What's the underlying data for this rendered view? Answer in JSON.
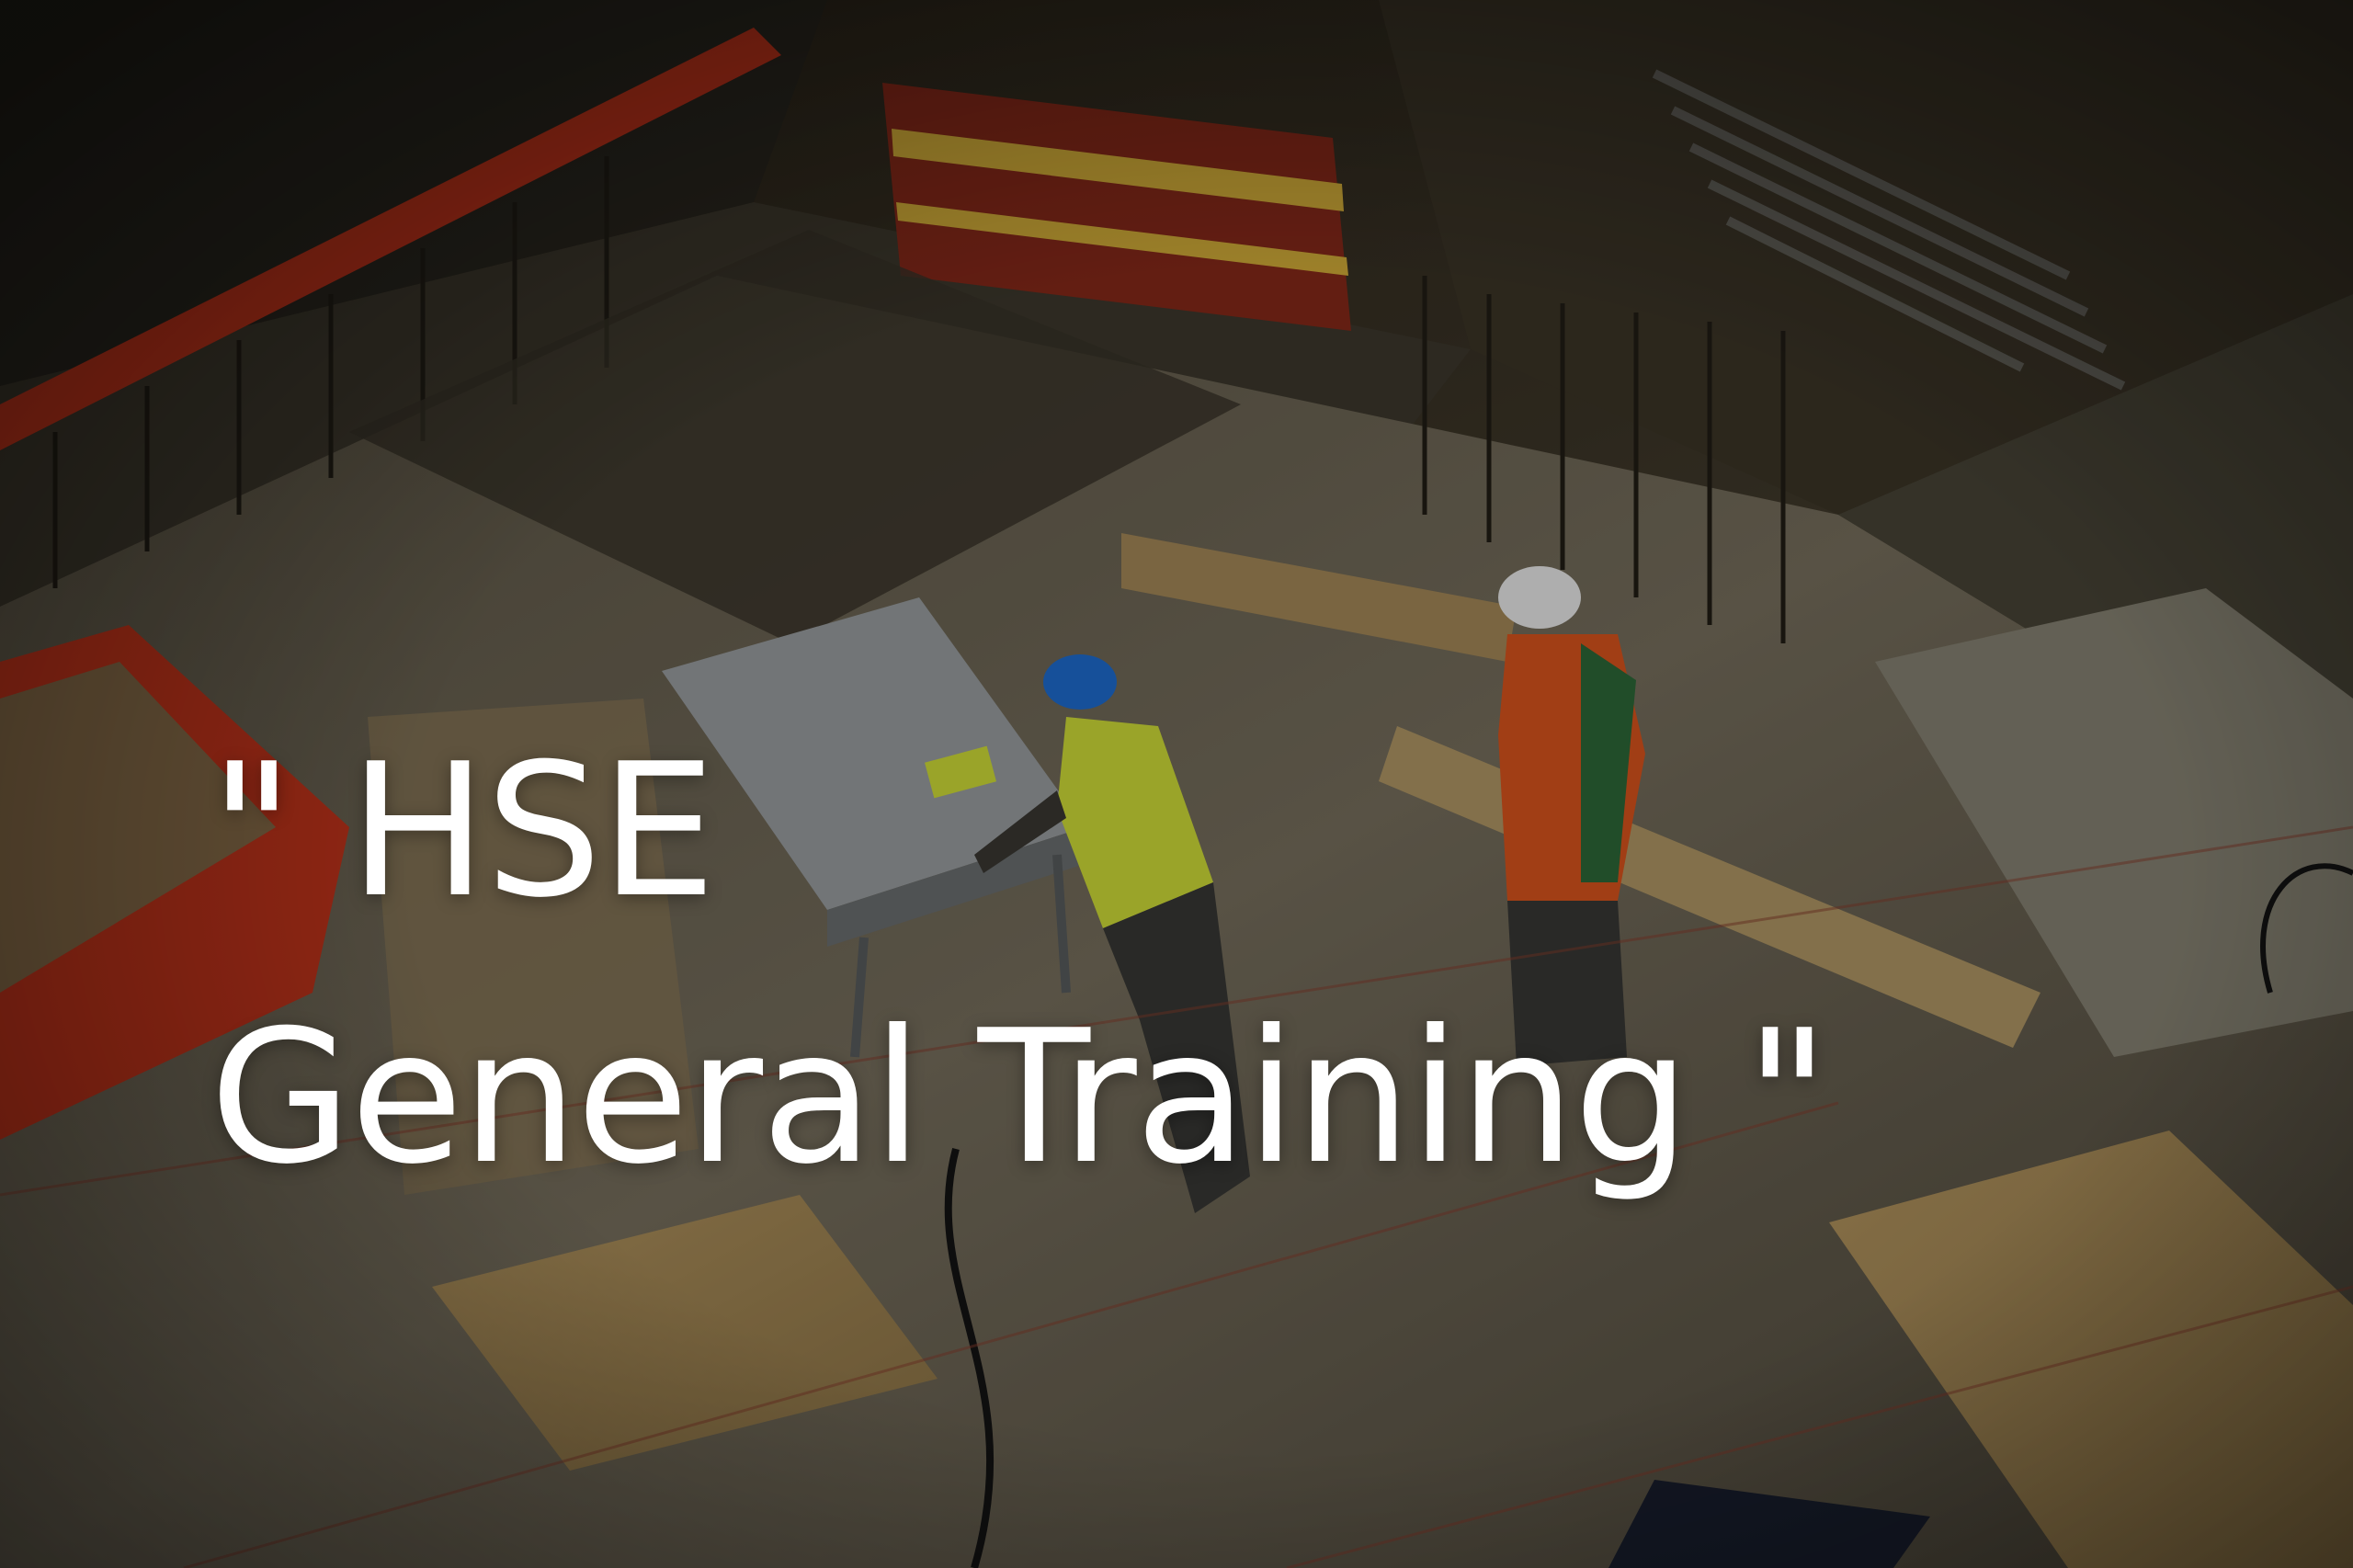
{
  "headline": {
    "line1": "\" HSE",
    "line2": "General Training \""
  },
  "colors": {
    "text": "#ffffff",
    "barrier": "#d9391e",
    "vest_yellow": "#d6e33a",
    "vest_orange": "#e0561e",
    "hardhat_blue": "#1f6fd6",
    "hardhat_white": "#f2f2f2",
    "plywood": "#b9975e"
  }
}
